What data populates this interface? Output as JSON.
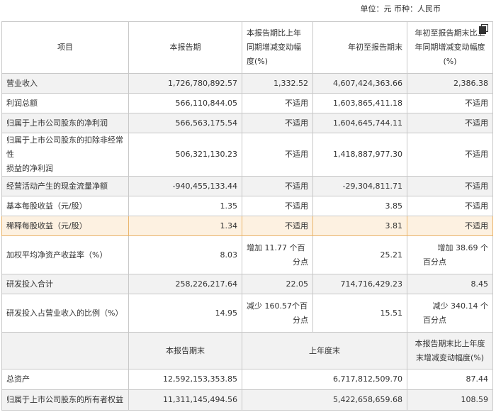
{
  "unit_line": "单位：元 币种：人民币",
  "header": {
    "item": "项目",
    "current": "本报告期",
    "yoy_line1": "本报告期比上年",
    "yoy_line2": "同期增减变动幅",
    "yoy_line3": "度(%)",
    "ytd": "年初至报告期末",
    "ytd_yoy_line1": "年初至报告期末比上",
    "ytd_yoy_line2": "年同期增减变动幅度",
    "ytd_yoy_line3": "(%)"
  },
  "rows": [
    {
      "label": "营业收入",
      "current": "1,726,780,892.57",
      "yoy": "1,332.52",
      "ytd": "4,607,424,363.66",
      "ytd_yoy": "2,386.38"
    },
    {
      "label": "利润总额",
      "current": "566,110,844.05",
      "yoy": "不适用",
      "ytd": "1,603,865,411.18",
      "ytd_yoy": "不适用"
    },
    {
      "label": "归属于上市公司股东的净利润",
      "current": "566,563,175.54",
      "yoy": "不适用",
      "ytd": "1,604,645,744.11",
      "ytd_yoy": "不适用"
    },
    {
      "label_line1": "归属于上市公司股东的扣除非经常性",
      "label_line2": "损益的净利润",
      "current": "506,321,130.23",
      "yoy": "不适用",
      "ytd": "1,418,887,977.30",
      "ytd_yoy": "不适用"
    },
    {
      "label": "经营活动产生的现金流量净额",
      "current": "-940,455,133.44",
      "yoy": "不适用",
      "ytd": "-29,304,811.71",
      "ytd_yoy": "不适用"
    },
    {
      "label": "基本每股收益（元/股）",
      "current": "1.35",
      "yoy": "不适用",
      "ytd": "3.85",
      "ytd_yoy": "不适用"
    },
    {
      "label": "稀释每股收益（元/股）",
      "current": "1.34",
      "yoy": "不适用",
      "ytd": "3.81",
      "ytd_yoy": "不适用"
    },
    {
      "label": "加权平均净资产收益率（%）",
      "current": "8.03",
      "yoy_line1": "增加 11.77 个百",
      "yoy_line2": "分点",
      "ytd": "25.21",
      "ytd_yoy_line1": "增加 38.69 个",
      "ytd_yoy_line2": "百分点"
    },
    {
      "label": "研发投入合计",
      "current": "258,226,217.64",
      "yoy": "22.05",
      "ytd": "714,716,429.23",
      "ytd_yoy": "8.45"
    },
    {
      "label": "研发投入占营业收入的比例（%）",
      "current": "14.95",
      "yoy_line1": "减少 160.57个百",
      "yoy_line2": "分点",
      "ytd": "15.51",
      "ytd_yoy_line1": "减少 340.14 个",
      "ytd_yoy_line2": "百分点"
    }
  ],
  "section2": {
    "header": {
      "period_end": "本报告期末",
      "last_year_end": "上年度末",
      "change_line1": "本报告期末比上年度",
      "change_line2": "末增减变动幅度(%)"
    },
    "rows": [
      {
        "label": "总资产",
        "period_end": "12,592,153,353.85",
        "last_year_end": "6,717,812,509.70",
        "change": "87.44"
      },
      {
        "label": "归属于上市公司股东的所有者权益",
        "period_end": "11,311,145,494.56",
        "last_year_end": "5,422,658,659.68",
        "change": "108.59"
      }
    ]
  }
}
